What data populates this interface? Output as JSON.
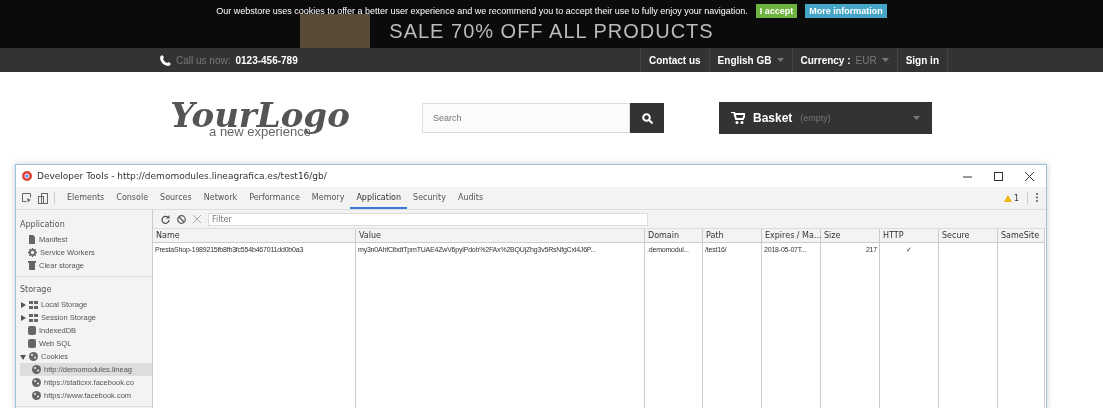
{
  "cookie_notice": {
    "text": "Our webstore uses cookies to offer a better user experience and we recommend you to accept their use to fully enjoy your navigation.",
    "buttons": [
      "I accept",
      "More information"
    ]
  },
  "banner": {
    "heading": "SALE 70% OFF ALL PRODUCTS"
  },
  "nav": {
    "phone_label": "Call us now:",
    "phone": "0123-456-789",
    "links": [
      {
        "label": "Contact us",
        "dropdown": false
      },
      {
        "label": "English GB",
        "dropdown": true
      },
      {
        "label": "Currency :",
        "value": "EUR",
        "dropdown": true
      },
      {
        "label": "Sign in",
        "dropdown": false
      }
    ]
  },
  "header": {
    "logo": "YourLogo",
    "tagline": "a new experience",
    "search": {
      "placeholder": "Search"
    },
    "basket": {
      "label": "Basket",
      "status": "(empty)"
    }
  },
  "devtools": {
    "title": "Developer Tools - http://demomodules.lineagrafica.es/test16/gb/",
    "tabs": [
      {
        "label": "Elements",
        "selected": false
      },
      {
        "label": "Console",
        "selected": false
      },
      {
        "label": "Sources",
        "selected": false
      },
      {
        "label": "Network",
        "selected": false
      },
      {
        "label": "Performance",
        "selected": false
      },
      {
        "label": "Memory",
        "selected": false
      },
      {
        "label": "Application",
        "selected": true
      },
      {
        "label": "Security",
        "selected": false
      },
      {
        "label": "Audits",
        "selected": false
      }
    ],
    "warnings": "1",
    "sidebar": [
      {
        "heading": "Application",
        "items": [
          {
            "label": "Manifest",
            "kind": "file",
            "selected": false
          },
          {
            "label": "Service Workers",
            "kind": "gear",
            "selected": false
          },
          {
            "label": "Clear storage",
            "kind": "bin",
            "selected": false
          }
        ]
      },
      {
        "heading": "Storage",
        "items": [
          {
            "label": "Local Storage",
            "kind": "grid",
            "expanded": false,
            "selected": false
          },
          {
            "label": "Session Storage",
            "kind": "grid",
            "expanded": false,
            "selected": false
          },
          {
            "label": "IndexedDB",
            "kind": "db",
            "selected": false
          },
          {
            "label": "Web SQL",
            "kind": "db",
            "selected": false
          },
          {
            "label": "Cookies",
            "kind": "cookie",
            "expanded": true,
            "selected": false,
            "children": [
              {
                "label": "http://demomodules.lineag",
                "kind": "cookie",
                "selected": true
              },
              {
                "label": "https://staticxx.facebook.co",
                "kind": "cookie",
                "selected": false
              },
              {
                "label": "https://www.facebook.com",
                "kind": "cookie",
                "selected": false
              }
            ]
          }
        ]
      }
    ],
    "filter": {
      "placeholder": "Filter"
    },
    "table": {
      "columns": [
        "Name",
        "Value",
        "Domain",
        "Path",
        "Expires / Ma...",
        "Size",
        "HTTP",
        "Secure",
        "SameSite"
      ],
      "rows": [
        {
          "cells": [
            "PrestaShop-1989215fb8fb3fc554b467011dd0b0a3",
            "my3n0AhfClbdtTpmTUAE4ZwV6pylPdoh%2FAx%2BQUjZhg3v5RsNfgCxl4J6P...",
            ".demomodul...",
            "/test16/",
            "2018-05-07T...",
            "217",
            "✓",
            "",
            ""
          ]
        }
      ]
    }
  }
}
